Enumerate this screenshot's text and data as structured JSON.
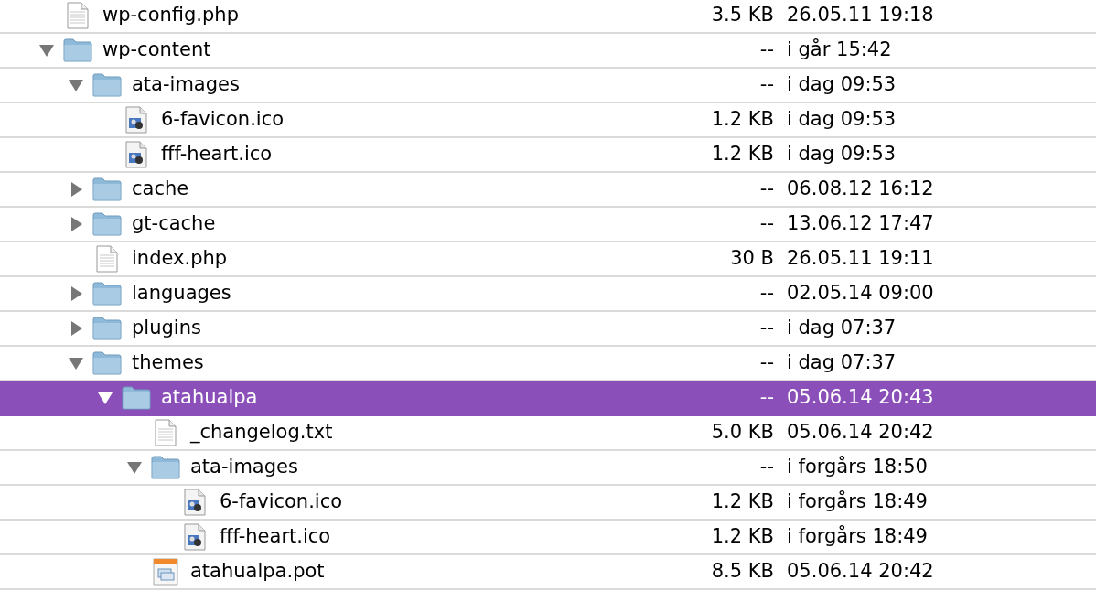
{
  "rows": [
    {
      "kind": "text",
      "name": "wp-config.php",
      "size": "3.5 KB",
      "date": "26.05.11 19:18",
      "selected": false
    },
    {
      "kind": "folder",
      "name": "wp-content",
      "size": "--",
      "date": "i går 15:42",
      "expanded": true,
      "selected": false,
      "children": [
        {
          "kind": "folder",
          "name": "ata-images",
          "size": "--",
          "date": "i dag 09:53",
          "expanded": true,
          "selected": false,
          "children": [
            {
              "kind": "image",
              "name": "6-favicon.ico",
              "size": "1.2 KB",
              "date": "i dag 09:53",
              "selected": false
            },
            {
              "kind": "image",
              "name": "fff-heart.ico",
              "size": "1.2 KB",
              "date": "i dag 09:53",
              "selected": false
            }
          ]
        },
        {
          "kind": "folder",
          "name": "cache",
          "size": "--",
          "date": "06.08.12 16:12",
          "expanded": false,
          "selected": false
        },
        {
          "kind": "folder",
          "name": "gt-cache",
          "size": "--",
          "date": "13.06.12 17:47",
          "expanded": false,
          "selected": false
        },
        {
          "kind": "text",
          "name": "index.php",
          "size": "30 B",
          "date": "26.05.11 19:11",
          "selected": false
        },
        {
          "kind": "folder",
          "name": "languages",
          "size": "--",
          "date": "02.05.14 09:00",
          "expanded": false,
          "selected": false
        },
        {
          "kind": "folder",
          "name": "plugins",
          "size": "--",
          "date": "i dag 07:37",
          "expanded": false,
          "selected": false
        },
        {
          "kind": "folder",
          "name": "themes",
          "size": "--",
          "date": "i dag 07:37",
          "expanded": true,
          "selected": false,
          "children": [
            {
              "kind": "folder",
              "name": "atahualpa",
              "size": "--",
              "date": "05.06.14 20:43",
              "expanded": true,
              "selected": true,
              "children": [
                {
                  "kind": "text",
                  "name": "_changelog.txt",
                  "size": "5.0 KB",
                  "date": "05.06.14 20:42",
                  "selected": false
                },
                {
                  "kind": "folder",
                  "name": "ata-images",
                  "size": "--",
                  "date": "i forgårs 18:50",
                  "expanded": true,
                  "selected": false,
                  "children": [
                    {
                      "kind": "image",
                      "name": "6-favicon.ico",
                      "size": "1.2 KB",
                      "date": "i forgårs 18:49",
                      "selected": false
                    },
                    {
                      "kind": "image",
                      "name": "fff-heart.ico",
                      "size": "1.2 KB",
                      "date": "i forgårs 18:49",
                      "selected": false
                    }
                  ]
                },
                {
                  "kind": "pot",
                  "name": "atahualpa.pot",
                  "size": "8.5 KB",
                  "date": "05.06.14 20:42",
                  "selected": false
                }
              ]
            }
          ]
        }
      ]
    }
  ]
}
